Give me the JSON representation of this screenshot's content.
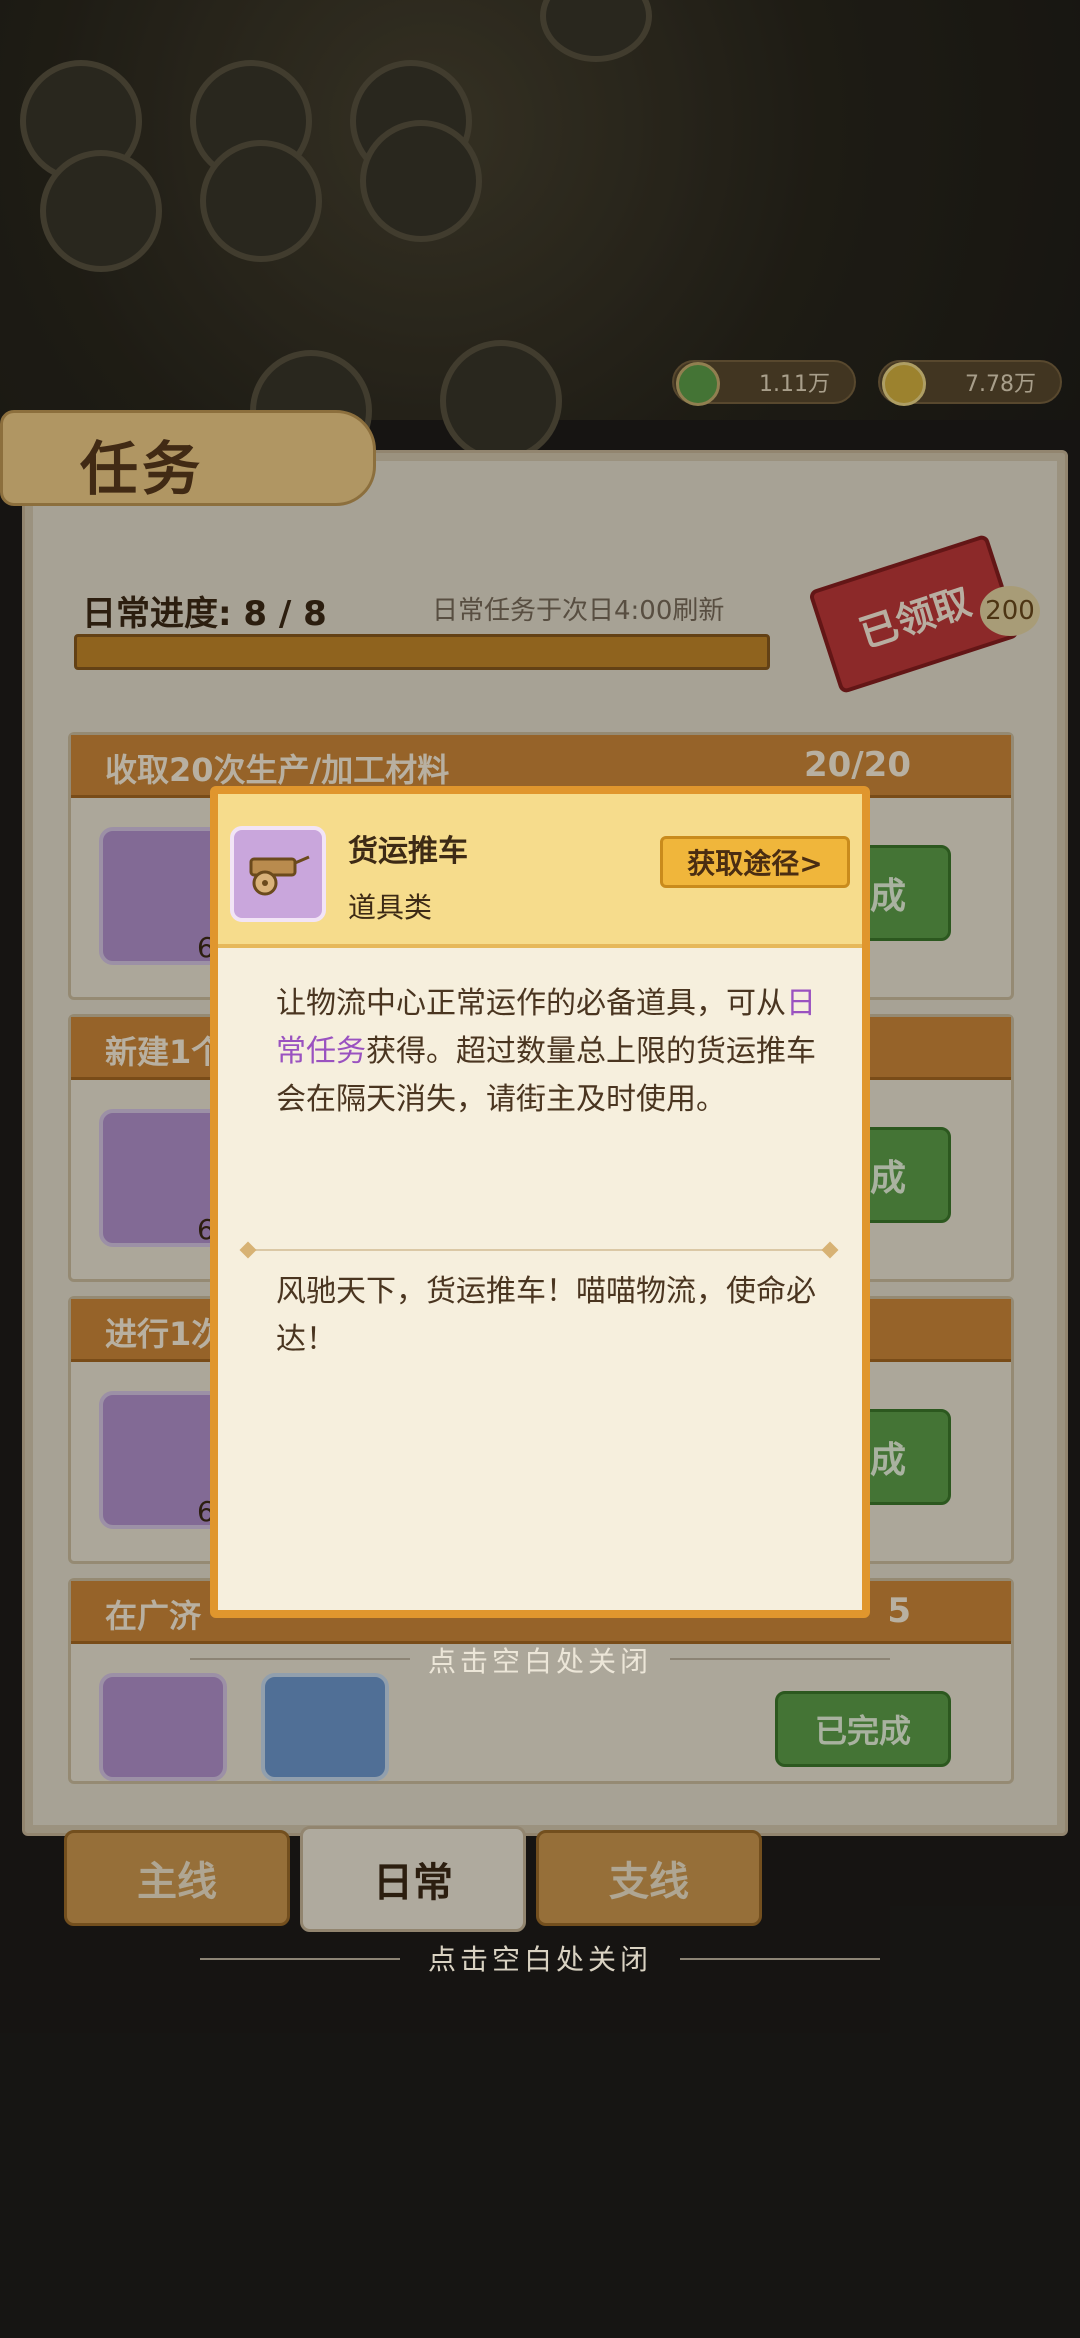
{
  "currency": {
    "silver_amount": "1.11万",
    "gold_amount": "7.78万"
  },
  "panel": {
    "title": "任务",
    "daily_progress_label": "日常进度: 8 / 8",
    "refresh_note": "日常任务于次日4:00刷新",
    "claimed_stamp": "已领取",
    "reward_badge": "200",
    "daily_progress_fraction": 1.0
  },
  "tasks": [
    {
      "name": "收取20次生产/加工材料",
      "progress": "20/20",
      "reward_qty": "6",
      "status": "成"
    },
    {
      "name": "新建1个",
      "progress": "",
      "reward_qty": "6",
      "status": "成"
    },
    {
      "name": "进行1次",
      "progress": "",
      "reward_qty": "6",
      "status": "成"
    },
    {
      "name": "在广济",
      "progress": "5",
      "reward_qty": "",
      "status": "已完成"
    }
  ],
  "tabs": [
    "主线",
    "日常",
    "支线"
  ],
  "close_hint": "点击空白处关闭",
  "popup": {
    "item_name": "货运推车",
    "item_type": "道具类",
    "source_button": "获取途径>",
    "desc_part1": "让物流中心正常运作的必备道具，可从",
    "desc_highlight": "日常任务",
    "desc_part2": "获得。超过数量总上限的货运推车会在隔天消失，请街主及时使用。",
    "flavor": "风驰天下，货运推车！喵喵物流，使命必达！",
    "close_hint": "点击空白处关闭"
  },
  "colors": {
    "accent_orange": "#e0962d",
    "highlight_purple": "#9a52c0",
    "done_green": "#5fa14a"
  }
}
